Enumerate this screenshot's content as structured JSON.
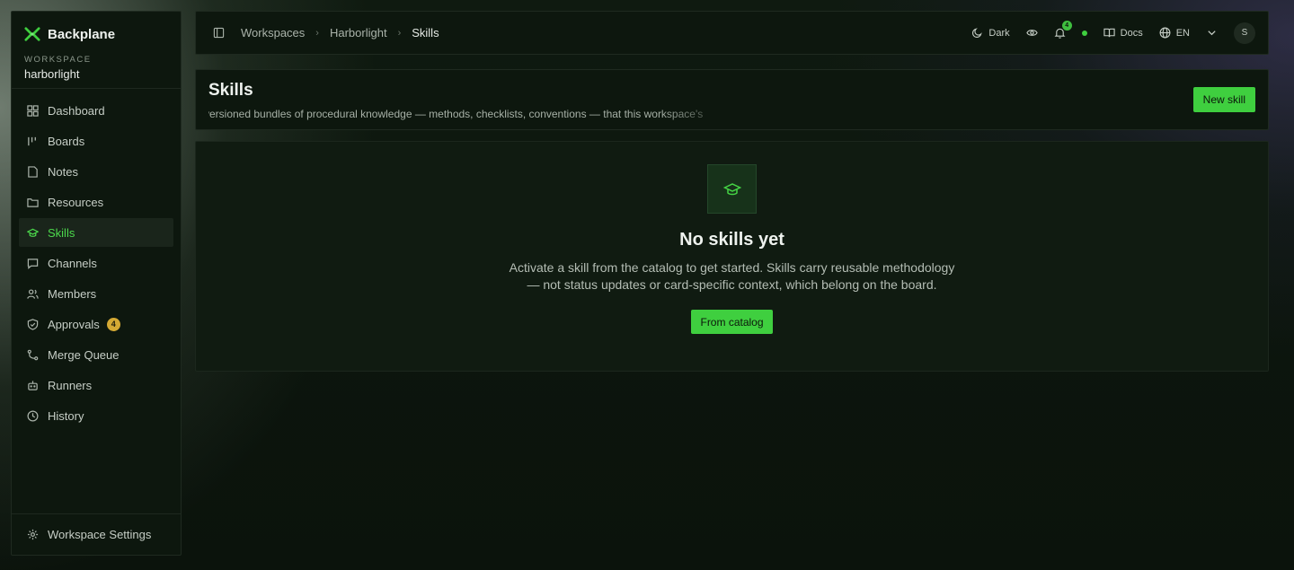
{
  "brand": {
    "name": "Backplane"
  },
  "workspace": {
    "caption": "WORKSPACE",
    "name": "harborlight"
  },
  "sidebar": {
    "items": [
      {
        "label": "Dashboard",
        "icon": "dashboard-icon"
      },
      {
        "label": "Boards",
        "icon": "boards-icon"
      },
      {
        "label": "Notes",
        "icon": "notes-icon"
      },
      {
        "label": "Resources",
        "icon": "folder-icon"
      },
      {
        "label": "Skills",
        "icon": "graduation-cap-icon",
        "active": true
      },
      {
        "label": "Channels",
        "icon": "chat-icon"
      },
      {
        "label": "Members",
        "icon": "users-icon"
      },
      {
        "label": "Approvals",
        "icon": "shield-check-icon",
        "badge": "4"
      },
      {
        "label": "Merge Queue",
        "icon": "merge-icon"
      },
      {
        "label": "Runners",
        "icon": "bot-icon"
      },
      {
        "label": "History",
        "icon": "clock-icon"
      }
    ],
    "footer_label": "Workspace Settings"
  },
  "topbar": {
    "breadcrumb": [
      "Workspaces",
      "Harborlight",
      "Skills"
    ],
    "theme_label": "Dark",
    "notification_count": "4",
    "docs_label": "Docs",
    "language": "EN",
    "avatar_initial": "S"
  },
  "page": {
    "title": "Skills",
    "description": "versioned bundles of procedural knowledge — methods, checklists, conventions — that this workspace's",
    "new_button": "New skill"
  },
  "empty_state": {
    "title": "No skills yet",
    "text": "Activate a skill from the catalog to get started. Skills carry reusable methodology — not status updates or card-specific context, which belong on the board.",
    "button": "From catalog"
  },
  "colors": {
    "accent": "#3fcf3f",
    "badge": "#d4a934",
    "background": "#0c150d"
  }
}
